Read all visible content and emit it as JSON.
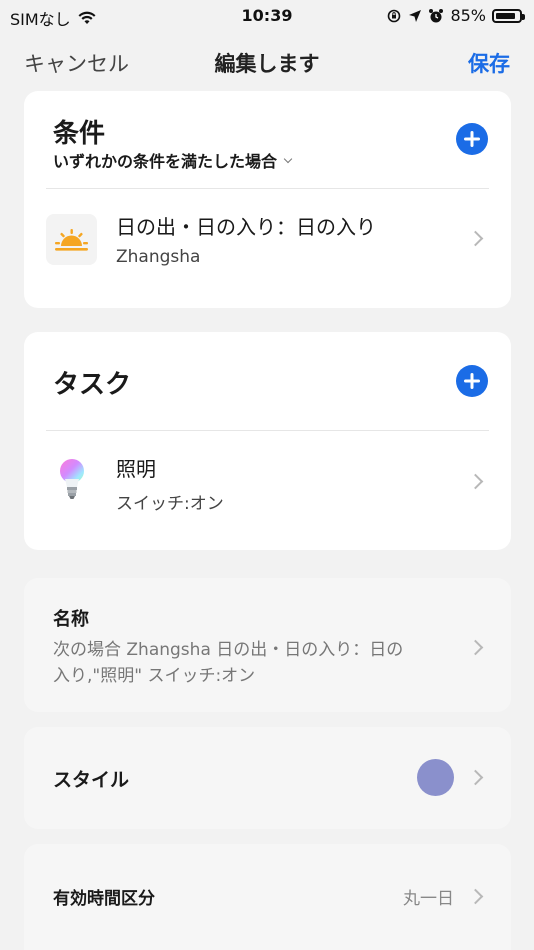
{
  "status_bar": {
    "carrier": "SIMなし",
    "time": "10:39",
    "battery": "85%",
    "battery_level": 0.85
  },
  "nav": {
    "cancel_label": "キャンセル",
    "title": "編集します",
    "save_label": "保存"
  },
  "conditions": {
    "title": "条件",
    "match_mode": "いずれかの条件を満たした場合",
    "items": [
      {
        "title": "日の出・日の入り：日の入り",
        "subtitle": "Zhangsha",
        "icon": "sunset-icon"
      }
    ]
  },
  "tasks": {
    "title": "タスク",
    "items": [
      {
        "title": "照明",
        "subtitle": "スイッチ:オン",
        "icon": "light-bulb-icon"
      }
    ]
  },
  "name_section": {
    "label": "名称",
    "value_line1": "次の場合 Zhangsha 日の出・日の入り：日の",
    "value_line2": "入り,\"照明\" スイッチ:オン"
  },
  "style_section": {
    "label": "スタイル",
    "color": "#8a90cc"
  },
  "valid_period": {
    "label": "有効時間区分",
    "value": "丸一日"
  },
  "colors": {
    "accent": "#1b6ce6",
    "sun": "#f5a623"
  }
}
